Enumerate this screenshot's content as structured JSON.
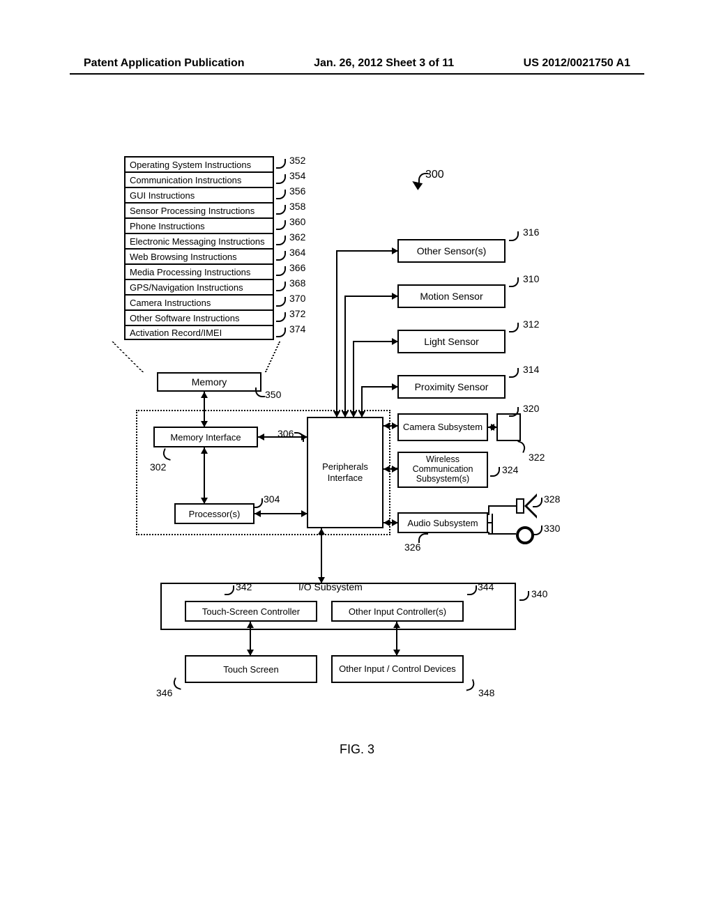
{
  "header": {
    "left": "Patent Application Publication",
    "center": "Jan. 26, 2012  Sheet 3 of 11",
    "right": "US 2012/0021750 A1"
  },
  "figure_label": "FIG. 3",
  "main_ref": "300",
  "memory": {
    "label": "Memory",
    "ref": "350",
    "rows": [
      {
        "label": "Operating System Instructions",
        "ref": "352"
      },
      {
        "label": "Communication Instructions",
        "ref": "354"
      },
      {
        "label": "GUI Instructions",
        "ref": "356"
      },
      {
        "label": "Sensor Processing Instructions",
        "ref": "358"
      },
      {
        "label": "Phone Instructions",
        "ref": "360"
      },
      {
        "label": "Electronic Messaging Instructions",
        "ref": "362"
      },
      {
        "label": "Web Browsing Instructions",
        "ref": "364"
      },
      {
        "label": "Media Processing Instructions",
        "ref": "366"
      },
      {
        "label": "GPS/Navigation Instructions",
        "ref": "368"
      },
      {
        "label": "Camera Instructions",
        "ref": "370"
      },
      {
        "label": "Other Software Instructions",
        "ref": "372"
      },
      {
        "label": "Activation Record/IMEI",
        "ref": "374"
      }
    ]
  },
  "sensors": {
    "other": {
      "label": "Other Sensor(s)",
      "ref": "316"
    },
    "motion": {
      "label": "Motion Sensor",
      "ref": "310"
    },
    "light": {
      "label": "Light Sensor",
      "ref": "312"
    },
    "proximity": {
      "label": "Proximity Sensor",
      "ref": "314"
    }
  },
  "subsystems": {
    "camera": {
      "label": "Camera Subsystem",
      "ref": "320",
      "periph_ref": "322"
    },
    "wireless": {
      "label": "Wireless Communication Subsystem(s)",
      "ref": "324"
    },
    "audio": {
      "label": "Audio Subsystem",
      "ref": "326",
      "speaker_ref": "328",
      "mic_ref": "330"
    }
  },
  "core": {
    "memory_interface": {
      "label": "Memory Interface",
      "ref": "302"
    },
    "processors": {
      "label": "Processor(s)",
      "ref": "304"
    },
    "peripherals": {
      "label": "Peripherals Interface",
      "ref": "306"
    }
  },
  "io": {
    "subsystem": {
      "label": "I/O Subsystem",
      "ref": "340"
    },
    "touch_controller": {
      "label": "Touch-Screen Controller",
      "ref": "342"
    },
    "other_controller": {
      "label": "Other Input Controller(s)",
      "ref": "344"
    },
    "touch_screen": {
      "label": "Touch Screen",
      "ref": "346"
    },
    "other_devices": {
      "label": "Other Input / Control Devices",
      "ref": "348"
    }
  }
}
